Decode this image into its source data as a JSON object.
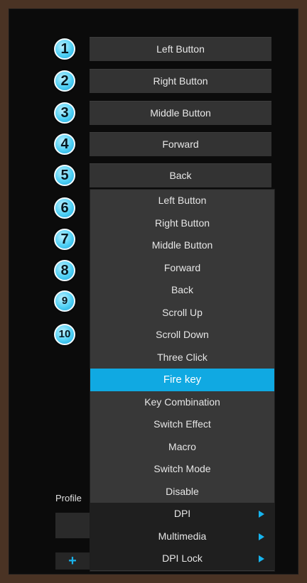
{
  "buttons": [
    {
      "number": "1",
      "assignment": "Left Button"
    },
    {
      "number": "2",
      "assignment": "Right Button"
    },
    {
      "number": "3",
      "assignment": "Middle Button"
    },
    {
      "number": "4",
      "assignment": "Forward"
    },
    {
      "number": "5",
      "assignment": "Back"
    },
    {
      "number": "6"
    },
    {
      "number": "7"
    },
    {
      "number": "8"
    },
    {
      "number": "9"
    },
    {
      "number": "10"
    }
  ],
  "dropdown": {
    "items": [
      "Left Button",
      "Right Button",
      "Middle Button",
      "Forward",
      "Back",
      "Scroll Up",
      "Scroll Down",
      "Three Click",
      "Fire key",
      "Key Combination",
      "Switch Effect",
      "Macro",
      "Switch Mode",
      "Disable"
    ],
    "selected": "Fire key",
    "submenus": [
      "DPI",
      "Multimedia",
      "DPI Lock"
    ]
  },
  "profile": {
    "label": "Profile",
    "add_icon": "+"
  },
  "colors": {
    "accent": "#10a9e2",
    "badge": "#4fd0f5",
    "panel_bg": "#0b0b0b",
    "frame": "#4a3324"
  }
}
